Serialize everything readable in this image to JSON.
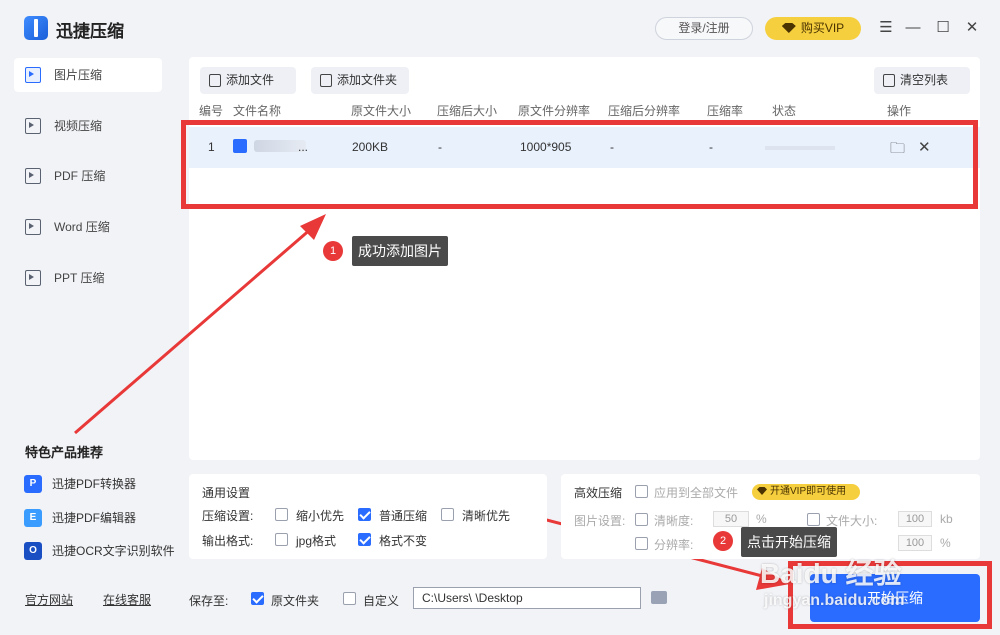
{
  "app": {
    "title": "迅捷压缩"
  },
  "header": {
    "login_label": "登录/注册",
    "vip_label": "购买VIP"
  },
  "sidebar": {
    "items": [
      {
        "label": "图片压缩"
      },
      {
        "label": "视频压缩"
      },
      {
        "label": "PDF 压缩"
      },
      {
        "label": "Word 压缩"
      },
      {
        "label": "PPT 压缩"
      }
    ],
    "recommend_title": "特色产品推荐",
    "recommend": [
      {
        "label": "迅捷PDF转换器"
      },
      {
        "label": "迅捷PDF编辑器"
      },
      {
        "label": "迅捷OCR文字识别软件"
      }
    ],
    "links": {
      "website": "官方网站",
      "service": "在线客服"
    }
  },
  "toolbar": {
    "add_file": "添加文件",
    "add_folder": "添加文件夹",
    "clear": "清空列表"
  },
  "table": {
    "headers": [
      "编号",
      "文件名称",
      "原文件大小",
      "压缩后大小",
      "原文件分辨率",
      "压缩后分辨率",
      "压缩率",
      "状态",
      "操作"
    ],
    "rows": [
      {
        "index": "1",
        "name": "...",
        "orig_size": "200KB",
        "comp_size": "-",
        "orig_res": "1000*905",
        "comp_res": "-",
        "ratio": "-"
      }
    ]
  },
  "annotations": {
    "step1": {
      "num": "1",
      "text": "成功添加图片"
    },
    "step2": {
      "num": "2",
      "text": "点击开始压缩"
    }
  },
  "general_settings": {
    "title": "通用设置",
    "compress_label": "压缩设置:",
    "compress_options": [
      "缩小优先",
      "普通压缩",
      "清晰优先"
    ],
    "format_label": "输出格式:",
    "format_options": [
      "jpg格式",
      "格式不变"
    ]
  },
  "advanced_settings": {
    "title": "高效压缩",
    "apply_all": "应用到全部文件",
    "vip_tag": "开通VIP即可使用",
    "image_label": "图片设置:",
    "clarity": "清晰度:",
    "clarity_value": "50",
    "clarity_unit": "%",
    "file_size": "文件大小:",
    "file_size_value": "100",
    "file_size_unit": "kb",
    "resolution": "分辨率:",
    "resolution_value": "100",
    "resolution_unit": "%"
  },
  "save": {
    "label": "保存至:",
    "original": "原文件夹",
    "custom": "自定义",
    "path": "C:\\Users\\      \\Desktop"
  },
  "start_button": "开始压缩",
  "watermark": {
    "brand": "Baidu 经验",
    "url": "jingyan.baidu.com"
  },
  "colors": {
    "accent": "#2a6cff",
    "annotation_red": "#e83838",
    "vip_yellow": "#f6cf3f"
  }
}
